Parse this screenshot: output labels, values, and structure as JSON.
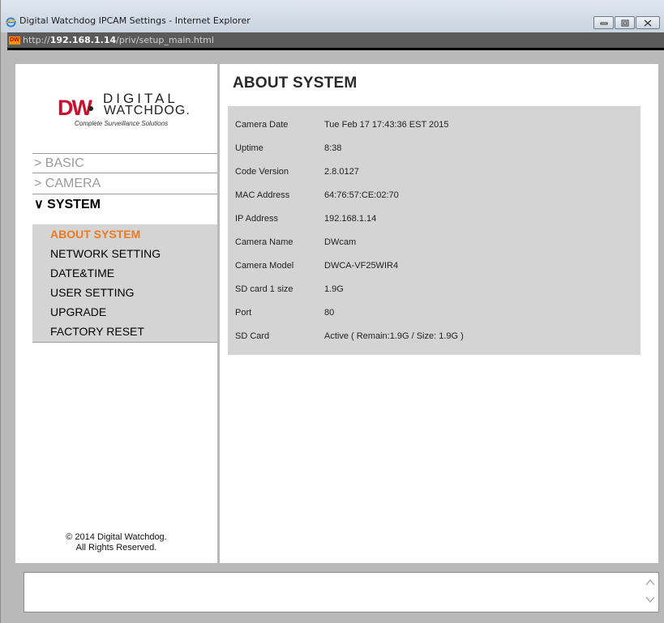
{
  "window": {
    "title": "Digital Watchdog IPCAM Settings - Internet Explorer",
    "url_prefix": "http://",
    "url_host": "192.168.1.14",
    "url_path": "/priv/setup_main.html"
  },
  "colors": {
    "accent_orange": "#ee7a21",
    "brand_red": "#c8102e",
    "panel_gray": "#d4d4d4",
    "frame_gray": "#b9b9b9"
  },
  "logo": {
    "digital": "DIGITAL",
    "watchdog": "WATCHDOG.",
    "tagline": "Complete Surveillance Solutions"
  },
  "sidebar": {
    "sections": [
      {
        "label": "> BASIC"
      },
      {
        "label": "> CAMERA"
      },
      {
        "label": "∨ SYSTEM"
      }
    ],
    "submenu": [
      {
        "label": "ABOUT SYSTEM"
      },
      {
        "label": "NETWORK SETTING"
      },
      {
        "label": "DATE&TIME"
      },
      {
        "label": "USER SETTING"
      },
      {
        "label": "UPGRADE"
      },
      {
        "label": "FACTORY RESET"
      }
    ],
    "copyright_line1": "© 2014 Digital Watchdog.",
    "copyright_line2": "All Rights Reserved."
  },
  "main": {
    "title": "ABOUT SYSTEM",
    "rows": [
      {
        "label": "Camera Date",
        "value": "Tue Feb 17 17:43:36 EST 2015"
      },
      {
        "label": "Uptime",
        "value": "8:38"
      },
      {
        "label": "Code Version",
        "value": "2.8.0127"
      },
      {
        "label": "MAC Address",
        "value": "64:76:57:CE:02:70"
      },
      {
        "label": "IP Address",
        "value": "192.168.1.14"
      },
      {
        "label": "Camera Name",
        "value": "DWcam"
      },
      {
        "label": "Camera Model",
        "value": "DWCA-VF25WIR4"
      },
      {
        "label": "SD card 1 size",
        "value": "1.9G"
      },
      {
        "label": "Port",
        "value": "80"
      },
      {
        "label": "SD Card",
        "value": "Active ( Remain:1.9G / Size: 1.9G )"
      }
    ]
  }
}
